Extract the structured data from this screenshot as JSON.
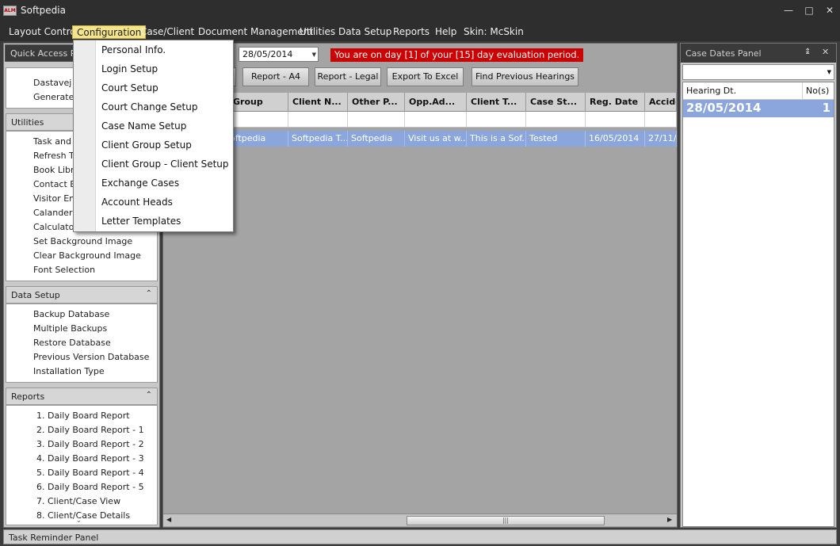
{
  "window": {
    "title": "Softpedia",
    "app_icon_text": "ALM"
  },
  "menubar": {
    "items": [
      {
        "label": "Layout Control"
      },
      {
        "label": "Configuration"
      },
      {
        "label": "Case/Client"
      },
      {
        "label": "Document Management"
      },
      {
        "label": "Utilities"
      },
      {
        "label": "Data Setup"
      },
      {
        "label": "Reports"
      },
      {
        "label": "Help"
      },
      {
        "label": "Skin: McSkin"
      }
    ]
  },
  "configuration_menu": {
    "items": [
      {
        "label": "Personal Info."
      },
      {
        "label": "Login Setup"
      },
      {
        "label": "Court Setup"
      },
      {
        "label": "Court Change Setup"
      },
      {
        "label": "Case Name Setup"
      },
      {
        "label": "Client Group Setup"
      },
      {
        "label": "Client Group - Client Setup"
      },
      {
        "label": "Exchange Cases"
      },
      {
        "label": "Account Heads"
      },
      {
        "label": "Letter Templates"
      }
    ]
  },
  "quick_access": {
    "title": "Quick Access Par",
    "items": [
      {
        "label": "Dastavej D"
      },
      {
        "label": "Generate"
      }
    ]
  },
  "utilities": {
    "title": "Utilities",
    "items": [
      {
        "label": "Task and F"
      },
      {
        "label": "Refresh Ta"
      },
      {
        "label": "Book Libra"
      },
      {
        "label": "Contact En"
      },
      {
        "label": "Visitor Ent"
      },
      {
        "label": "Calander"
      },
      {
        "label": "Calculator"
      },
      {
        "label": "Set Background Image"
      },
      {
        "label": "Clear Background Image"
      },
      {
        "label": "Font Selection"
      }
    ]
  },
  "data_setup": {
    "title": "Data Setup",
    "items": [
      {
        "label": "Backup Database"
      },
      {
        "label": "Multiple Backups"
      },
      {
        "label": "Restore Database"
      },
      {
        "label": "Previous Version Database"
      },
      {
        "label": "Installation Type"
      }
    ]
  },
  "reports": {
    "title": "Reports",
    "items": [
      {
        "label": "1. Daily Board Report"
      },
      {
        "label": "2. Daily Board Report - 1"
      },
      {
        "label": "3. Daily Board Report - 2"
      },
      {
        "label": "4. Daily Board Report - 3"
      },
      {
        "label": "5. Daily Board Report - 4"
      },
      {
        "label": "6. Daily Board Report - 5"
      },
      {
        "label": "7. Client/Case View"
      },
      {
        "label": "8. Client/Case Details"
      }
    ]
  },
  "main": {
    "date": "28/05/2014",
    "eval_message": "You are on day [1] of your [15] day evaluation period.",
    "buttons": [
      {
        "label": "Report - A4"
      },
      {
        "label": "Report - Legal"
      },
      {
        "label": "Export To Excel"
      },
      {
        "label": "Find Previous Hearings"
      }
    ],
    "columns": [
      "Group",
      "Client N...",
      "Other P...",
      "Opp.Ad...",
      "Client T...",
      "Case St...",
      "Reg. Date",
      "Accide"
    ],
    "row": [
      "oftpedia",
      "Softpedia T...",
      "Softpedia",
      "Visit us at w...",
      "This is a Sof...",
      "Tested",
      "16/05/2014",
      "27/11/2"
    ]
  },
  "case_dates_panel": {
    "title": "Case Dates Panel",
    "col_date": "Hearing Dt.",
    "col_count": "No(s)",
    "row_date": "28/05/2014",
    "row_count": "1"
  },
  "statusbar": {
    "text": "Task Reminder Panel"
  },
  "icons": {
    "pin": "pin-icon",
    "close": "close-icon",
    "collapse": "collapse-chevron-icon",
    "dropdown": "dropdown-arrow-icon"
  },
  "colors": {
    "menu_highlight": "#f5e58a",
    "selection_blue": "#8aa6dc",
    "eval_red": "#cc0000"
  }
}
